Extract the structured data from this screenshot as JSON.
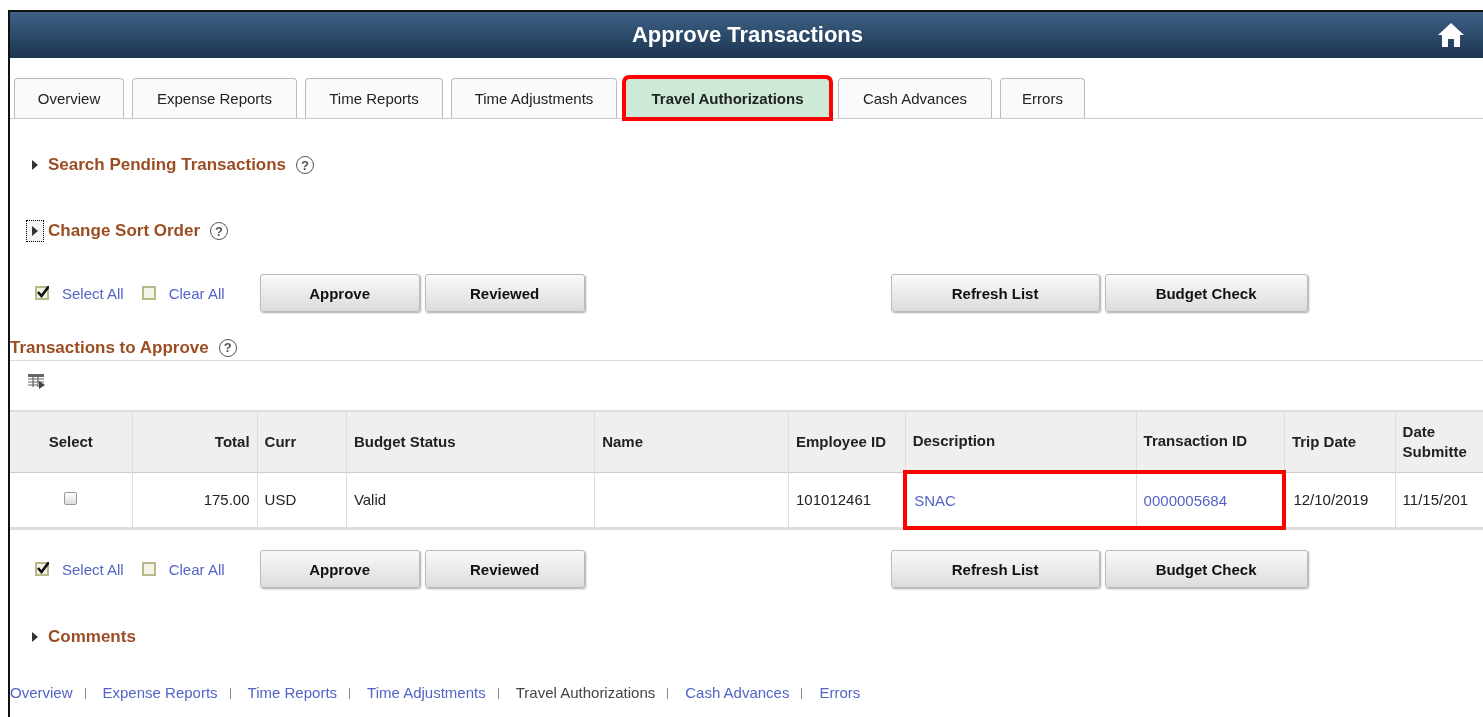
{
  "window": {
    "title": "Approve Transactions"
  },
  "tabs": [
    {
      "label": "Overview",
      "selected": false,
      "outlined": false
    },
    {
      "label": "Expense Reports",
      "selected": false,
      "outlined": false
    },
    {
      "label": "Time Reports",
      "selected": false,
      "outlined": false
    },
    {
      "label": "Time Adjustments",
      "selected": false,
      "outlined": false
    },
    {
      "label": "Travel Authorizations",
      "selected": true,
      "outlined": true
    },
    {
      "label": "Cash Advances",
      "selected": false,
      "outlined": false
    },
    {
      "label": "Errors",
      "selected": false,
      "outlined": false
    }
  ],
  "sections": [
    {
      "title": "Search Pending Transactions",
      "expanded": false,
      "focused": false,
      "help": "?"
    },
    {
      "title": "Change Sort Order",
      "expanded": false,
      "focused": true,
      "help": "?"
    }
  ],
  "action_bars": [
    {
      "select_all": {
        "label": "Select All",
        "checked": true
      },
      "clear_all": {
        "label": "Clear All",
        "checked": false
      },
      "left_buttons": [
        "Approve",
        "Reviewed"
      ],
      "right_buttons": [
        "Refresh List",
        "Budget Check"
      ]
    },
    {
      "select_all": {
        "label": "Select All",
        "checked": true
      },
      "clear_all": {
        "label": "Clear All",
        "checked": false
      },
      "left_buttons": [
        "Approve",
        "Reviewed"
      ],
      "right_buttons": [
        "Refresh List",
        "Budget Check"
      ]
    }
  ],
  "table": {
    "title": "Transactions to Approve",
    "help": "?",
    "columns": [
      {
        "label": "Select",
        "kind": "check"
      },
      {
        "label": "Total",
        "kind": "amount"
      },
      {
        "label": "Curr",
        "kind": "text"
      },
      {
        "label": "Budget Status",
        "kind": "text"
      },
      {
        "label": "Name",
        "kind": "text"
      },
      {
        "label": "Employee ID",
        "kind": "text"
      },
      {
        "label": "Description",
        "kind": "link"
      },
      {
        "label": "Transaction ID",
        "kind": "link"
      },
      {
        "label": "Trip Date",
        "kind": "text"
      },
      {
        "label": "Date Submitte",
        "kind": "text"
      }
    ],
    "rows": [
      {
        "selected": false,
        "outlined": true,
        "cells": [
          null,
          "175.00",
          "USD",
          "Valid",
          null,
          "101012461",
          "SNAC",
          "0000005684",
          "12/10/2019",
          "11/15/201"
        ]
      }
    ]
  },
  "comments": {
    "title": "Comments",
    "expanded": false
  },
  "footer_links": [
    {
      "label": "Overview",
      "current": false
    },
    {
      "label": "Expense Reports",
      "current": false
    },
    {
      "label": "Time Reports",
      "current": false
    },
    {
      "label": "Time Adjustments",
      "current": false
    },
    {
      "label": "Travel Authorizations",
      "current": true
    },
    {
      "label": "Cash Advances",
      "current": false
    },
    {
      "label": "Errors",
      "current": false
    }
  ]
}
